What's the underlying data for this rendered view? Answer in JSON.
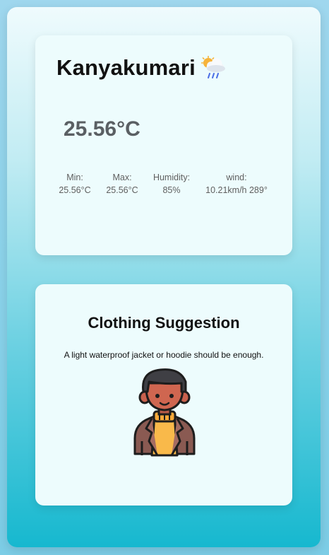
{
  "weather": {
    "city": "Kanyakumari",
    "icon": "cloud-sun-rain-icon",
    "temperature": "25.56°C",
    "stats": {
      "min_label": "Min:",
      "min_value": "25.56°C",
      "max_label": "Max:",
      "max_value": "25.56°C",
      "humidity_label": "Humidity:",
      "humidity_value": "85%",
      "wind_label": "wind:",
      "wind_value": "10.21km/h 289°"
    }
  },
  "clothing": {
    "title": "Clothing Suggestion",
    "suggestion": "A light waterproof jacket or hoodie should be enough.",
    "image_icon": "person-in-jacket-icon"
  },
  "colors": {
    "card_bg": "#edfcfd",
    "temp_text": "#5a5f63",
    "gradient_bottom": "#16b8cf"
  }
}
